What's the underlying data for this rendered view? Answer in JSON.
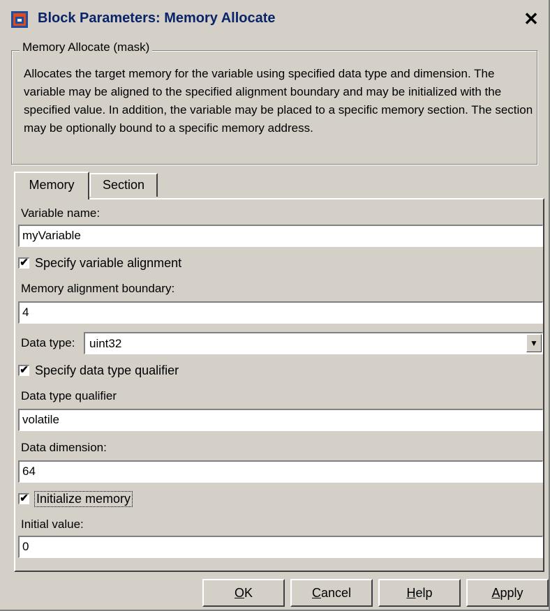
{
  "window": {
    "title": "Block Parameters: Memory Allocate",
    "close_glyph": "✕",
    "icon": "simulink-block-icon"
  },
  "group": {
    "legend": "Memory Allocate (mask)",
    "description": "Allocates the target memory for the variable using specified data type and dimension. The variable may be aligned to the specified alignment boundary and may be initialized with the specified value. In addition, the variable may be placed to a specific memory section. The section may be optionally bound to a specific memory address."
  },
  "tabs": [
    {
      "label": "Memory",
      "active": true
    },
    {
      "label": "Section",
      "active": false
    }
  ],
  "form": {
    "variable_name_label": "Variable name:",
    "variable_name_value": "myVariable",
    "specify_alignment_label": "Specify variable alignment",
    "specify_alignment_checked": true,
    "alignment_boundary_label": "Memory alignment boundary:",
    "alignment_boundary_value": "4",
    "data_type_label": "Data type:",
    "data_type_value": "uint32",
    "specify_qualifier_label": "Specify data type qualifier",
    "specify_qualifier_checked": true,
    "qualifier_label": "Data type qualifier",
    "qualifier_value": "volatile",
    "dimension_label": "Data dimension:",
    "dimension_value": "64",
    "initialize_label": "Initialize memory",
    "initialize_checked": true,
    "initial_value_label": "Initial value:",
    "initial_value_value": "0"
  },
  "buttons": {
    "ok": {
      "mnemonic": "O",
      "rest": "K"
    },
    "cancel": {
      "mnemonic": "C",
      "rest": "ancel"
    },
    "help": {
      "mnemonic": "H",
      "rest": "elp"
    },
    "apply": {
      "mnemonic": "A",
      "rest": "pply"
    }
  },
  "check_glyph": "✔",
  "dropdown_glyph": "▼",
  "colors": {
    "title_text": "#0a246a",
    "face": "#d4d0c8"
  }
}
